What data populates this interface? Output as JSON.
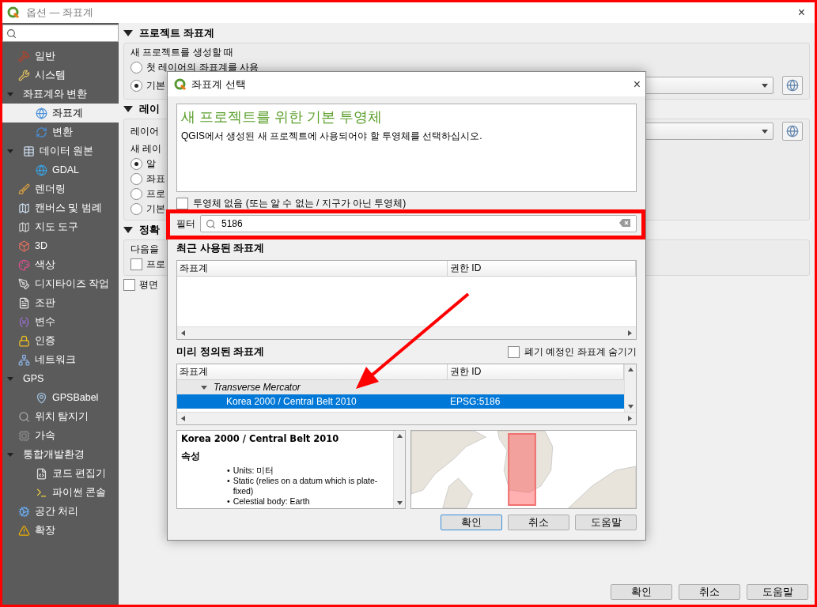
{
  "window": {
    "title": "옵션 — 좌표계",
    "close": "×"
  },
  "sidebar": {
    "items": [
      {
        "label": "일반",
        "selected": false
      },
      {
        "label": "시스템",
        "selected": false
      },
      {
        "label": "좌표계와 변환",
        "selected": false,
        "expanded": true,
        "children": [
          {
            "label": "좌표계",
            "selected": true
          },
          {
            "label": "변환",
            "selected": false
          }
        ]
      },
      {
        "label": "데이터 원본",
        "selected": false,
        "expanded": true,
        "children": [
          {
            "label": "GDAL",
            "selected": false
          }
        ]
      },
      {
        "label": "렌더링",
        "selected": false
      },
      {
        "label": "캔버스 및 범례",
        "selected": false
      },
      {
        "label": "지도 도구",
        "selected": false
      },
      {
        "label": "3D",
        "selected": false
      },
      {
        "label": "색상",
        "selected": false
      },
      {
        "label": "디지타이즈 작업",
        "selected": false
      },
      {
        "label": "조판",
        "selected": false
      },
      {
        "label": "변수",
        "selected": false
      },
      {
        "label": "인증",
        "selected": false
      },
      {
        "label": "네트워크",
        "selected": false
      },
      {
        "label": "GPS",
        "selected": false,
        "expanded": true,
        "children": [
          {
            "label": "GPSBabel",
            "selected": false
          }
        ]
      },
      {
        "label": "위치 탐지기",
        "selected": false
      },
      {
        "label": "가속",
        "selected": false
      },
      {
        "label": "통합개발환경",
        "selected": false,
        "expanded": true,
        "children": [
          {
            "label": "코드 편집기",
            "selected": false
          },
          {
            "label": "파이썬 콘솔",
            "selected": false
          }
        ]
      },
      {
        "label": "공간 처리",
        "selected": false
      },
      {
        "label": "확장",
        "selected": false
      }
    ]
  },
  "sections": [
    {
      "title": "프로젝트 좌표계",
      "expanded": true,
      "rows": [
        {
          "kind": "label",
          "label": "새 프로젝트를 생성할 때"
        },
        {
          "kind": "radio",
          "label": "첫 레이어의 좌표계를 사용",
          "checked": false
        },
        {
          "kind": "radio",
          "label": "기본",
          "checked": true,
          "combo": true
        }
      ]
    },
    {
      "title": "레이",
      "expanded": true,
      "rows": [
        {
          "kind": "label",
          "label": "레이어",
          "combo": true
        },
        {
          "kind": "label",
          "label": "새 레이"
        },
        {
          "kind": "radio",
          "label": "알",
          "checked": true
        },
        {
          "kind": "radio",
          "label": "좌표",
          "checked": false
        },
        {
          "kind": "radio",
          "label": "프로",
          "checked": false
        },
        {
          "kind": "radio",
          "label": "기본",
          "checked": false
        }
      ]
    },
    {
      "title": "정확",
      "expanded": true,
      "rows": [
        {
          "kind": "label",
          "label": "다음을"
        },
        {
          "kind": "checkbox",
          "label": "프로",
          "checked": false
        }
      ]
    }
  ],
  "extra_checkbox": {
    "label": "평면",
    "checked": false
  },
  "buttons": [
    "확인",
    "취소",
    "도움말"
  ],
  "dialog": {
    "title": "좌표계 선택",
    "close": "×",
    "heading": "새 프로젝트를 위한 기본 투영체",
    "description": "QGIS에서 생성된 새 프로젝트에 사용되어야 할 투영체를 선택하십시오.",
    "no_projection": {
      "label": "투영체 없음 (또는 알 수 없는 / 지구가 아닌 투영체)",
      "checked": false
    },
    "filter": {
      "label": "필터",
      "value": "5186"
    },
    "recent": {
      "title": "최근 사용된 좌표계",
      "columns": [
        "좌표계",
        "권한 ID"
      ]
    },
    "predefined": {
      "title": "미리 정의된 좌표계",
      "hide_deprecated": {
        "label": "폐기 예정인 좌표계 숨기기",
        "checked": false
      },
      "columns": [
        "좌표계",
        "권한 ID"
      ],
      "groups": [
        {
          "name": "Transverse Mercator",
          "expanded": true,
          "children": [
            {
              "name": "Korea 2000 / Central Belt 2010",
              "authority_id": "EPSG:5186",
              "selected": true
            }
          ]
        }
      ]
    },
    "details": {
      "title": "Korea 2000 / Central Belt 2010",
      "section": "속성",
      "bullets": [
        {
          "marker": "•",
          "text": "Units: 미터"
        },
        {
          "marker": "•",
          "text": "Static (relies on a datum which is plate-fixed)"
        },
        {
          "marker": "•",
          "text": "Celestial body: Earth"
        }
      ]
    },
    "buttons": [
      {
        "label": "확인",
        "focused": true
      },
      {
        "label": "취소",
        "focused": false
      },
      {
        "label": "도움말",
        "focused": false
      }
    ]
  }
}
